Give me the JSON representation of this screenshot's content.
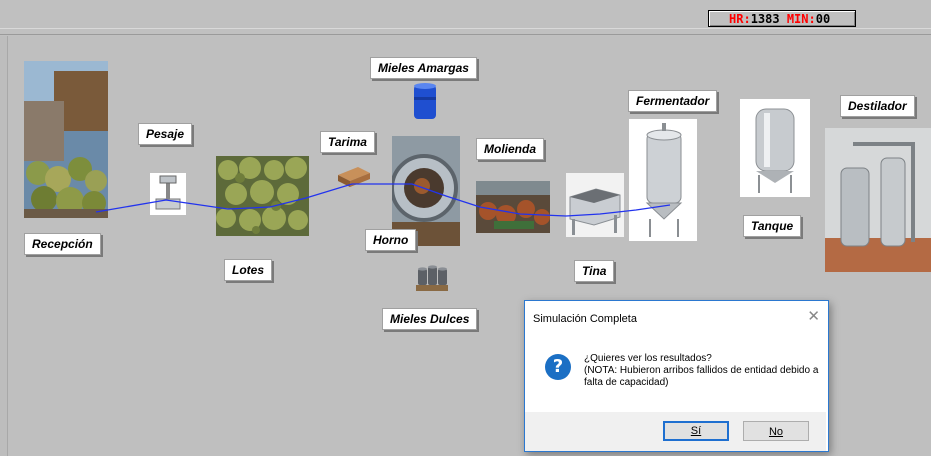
{
  "status_bar": {
    "hr_label": "HR:",
    "hr_value": "1383",
    "min_label": "MIN:",
    "min_value": "00"
  },
  "stations": {
    "recepcion": "Recepción",
    "pesaje": "Pesaje",
    "lotes": "Lotes",
    "tarima": "Tarima",
    "mieles_amargas": "Mieles Amargas",
    "horno": "Horno",
    "mieles_dulces": "Mieles Dulces",
    "molienda": "Molienda",
    "tina": "Tina",
    "fermentador": "Fermentador",
    "tanque": "Tanque",
    "destilador": "Destilador"
  },
  "dialog": {
    "title": "Simulación Completa",
    "question_line": "¿Quieres ver los resultados?",
    "note_line": "(NOTA: Hubieron arribos fallidos de entidad debido a falta de capacidad)",
    "yes_button": "Sí",
    "no_button": "No",
    "close_glyph": "✕",
    "icon_glyph": "?"
  },
  "colors": {
    "flow_line": "#2233ee",
    "dialog_accent": "#1e6fd0",
    "hour_label": "#ff0000"
  }
}
